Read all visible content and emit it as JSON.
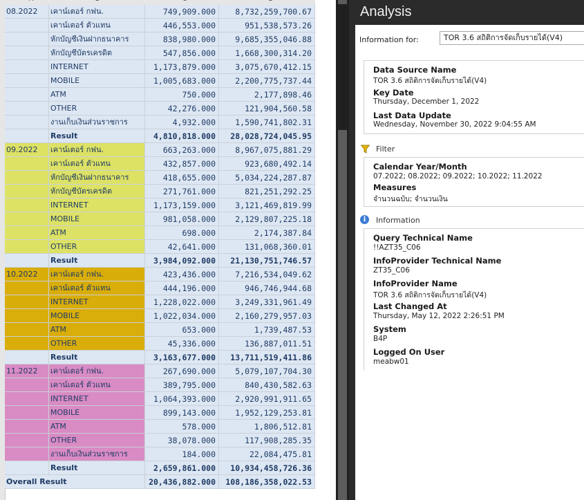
{
  "sheet": {
    "columns": [
      "A",
      "B",
      "C",
      "D"
    ],
    "rows": [
      {
        "period": "08.2022",
        "item": "เคาน์เตอร์ กฟน.",
        "qty": "749,909.000",
        "amount": "8,732,259,700.67",
        "style": "hb",
        "tri": true
      },
      {
        "period": "",
        "item": "เคาน์เตอร์ ตัวแทน",
        "qty": "446,553.000",
        "amount": "951,538,573.26",
        "style": "hb"
      },
      {
        "period": "",
        "item": "หักบัญชีเงินฝากธนาคาร",
        "qty": "838,980.000",
        "amount": "9,685,355,046.88",
        "style": "hb"
      },
      {
        "period": "",
        "item": "หักบัญชีบัตรเครดิต",
        "qty": "547,856.000",
        "amount": "1,668,300,314.20",
        "style": "hb"
      },
      {
        "period": "",
        "item": "INTERNET",
        "qty": "1,173,879.000",
        "amount": "3,075,670,412.15",
        "style": "hb"
      },
      {
        "period": "",
        "item": "MOBILE",
        "qty": "1,005,683.000",
        "amount": "2,200,775,737.44",
        "style": "hb"
      },
      {
        "period": "",
        "item": "ATM",
        "qty": "750.000",
        "amount": "2,177,898.46",
        "style": "hb"
      },
      {
        "period": "",
        "item": "OTHER",
        "qty": "42,276.000",
        "amount": "121,904,560.58",
        "style": "hb"
      },
      {
        "period": "",
        "item": "งานเก็บเงินส่วนราชการ",
        "qty": "4,932.000",
        "amount": "1,590,741,802.31",
        "style": "hb"
      },
      {
        "period": "",
        "item": "Result",
        "qty": "4,810,818.000",
        "amount": "28,028,724,045.95",
        "style": "hb",
        "result": true
      },
      {
        "period": "09.2022",
        "item": "เคาน์เตอร์ กฟน.",
        "qty": "663,263.000",
        "amount": "8,967,075,881.29",
        "style": "hy",
        "tri": true
      },
      {
        "period": "",
        "item": "เคาน์เตอร์ ตัวแทน",
        "qty": "432,857.000",
        "amount": "923,680,492.14",
        "style": "hy"
      },
      {
        "period": "",
        "item": "หักบัญชีเงินฝากธนาคาร",
        "qty": "418,655.000",
        "amount": "5,034,224,287.87",
        "style": "hy"
      },
      {
        "period": "",
        "item": "หักบัญชีบัตรเครดิต",
        "qty": "271,761.000",
        "amount": "821,251,292.25",
        "style": "hy"
      },
      {
        "period": "",
        "item": "INTERNET",
        "qty": "1,173,159.000",
        "amount": "3,121,469,819.99",
        "style": "hy"
      },
      {
        "period": "",
        "item": "MOBILE",
        "qty": "981,058.000",
        "amount": "2,129,807,225.18",
        "style": "hy"
      },
      {
        "period": "",
        "item": "ATM",
        "qty": "698.000",
        "amount": "2,174,387.84",
        "style": "hy"
      },
      {
        "period": "",
        "item": "OTHER",
        "qty": "42,641.000",
        "amount": "131,068,360.01",
        "style": "hy"
      },
      {
        "period": "",
        "item": "Result",
        "qty": "3,984,092.000",
        "amount": "21,130,751,746.57",
        "style": "hw",
        "result": true
      },
      {
        "period": "10.2022",
        "item": "เคาน์เตอร์ กฟน.",
        "qty": "423,436.000",
        "amount": "7,216,534,049.62",
        "style": "ho",
        "tri": true
      },
      {
        "period": "",
        "item": "เคาน์เตอร์ ตัวแทน",
        "qty": "444,196.000",
        "amount": "946,746,944.68",
        "style": "ho"
      },
      {
        "period": "",
        "item": "INTERNET",
        "qty": "1,228,022.000",
        "amount": "3,249,331,961.49",
        "style": "ho"
      },
      {
        "period": "",
        "item": "MOBILE",
        "qty": "1,022,034.000",
        "amount": "2,160,279,957.03",
        "style": "ho"
      },
      {
        "period": "",
        "item": "ATM",
        "qty": "653.000",
        "amount": "1,739,487.53",
        "style": "ho"
      },
      {
        "period": "",
        "item": "OTHER",
        "qty": "45,336.000",
        "amount": "136,887,011.51",
        "style": "ho"
      },
      {
        "period": "",
        "item": "Result",
        "qty": "3,163,677.000",
        "amount": "13,711,519,411.86",
        "style": "hw",
        "result": true
      },
      {
        "period": "11.2022",
        "item": "เคาน์เตอร์ กฟน.",
        "qty": "267,690.000",
        "amount": "5,079,107,704.30",
        "style": "hp",
        "tri": true
      },
      {
        "period": "",
        "item": "เคาน์เตอร์ ตัวแทน",
        "qty": "389,795.000",
        "amount": "840,430,582.63",
        "style": "hp"
      },
      {
        "period": "",
        "item": "INTERNET",
        "qty": "1,064,393.000",
        "amount": "2,920,991,911.65",
        "style": "hp"
      },
      {
        "period": "",
        "item": "MOBILE",
        "qty": "899,143.000",
        "amount": "1,952,129,253.81",
        "style": "hp"
      },
      {
        "period": "",
        "item": "ATM",
        "qty": "578.000",
        "amount": "1,806,512.81",
        "style": "hp"
      },
      {
        "period": "",
        "item": "OTHER",
        "qty": "38,078.000",
        "amount": "117,908,285.35",
        "style": "hp"
      },
      {
        "period": "",
        "item": "งานเก็บเงินส่วนราชการ",
        "qty": "184.000",
        "amount": "22,084,475.81",
        "style": "hp"
      },
      {
        "period": "",
        "item": "Result",
        "qty": "2,659,861.000",
        "amount": "10,934,458,726.36",
        "style": "hw",
        "result": true
      },
      {
        "period": "Overall Result",
        "item": "",
        "qty": "20,436,882.000",
        "amount": "108,186,358,022.53",
        "style": "hw",
        "overall": true
      }
    ]
  },
  "analysis": {
    "title": "Analysis",
    "info_for_label": "Information for:",
    "info_for_value": "TOR 3.6 สถิติการจัดเก็บรายได้(V4)",
    "data_source": {
      "l1": "Data Source Name",
      "v1": "TOR 3.6 สถิติการจัดเก็บรายได้(V4)",
      "l2": "Key Date",
      "v2": "Thursday, December 1, 2022",
      "l3": "Last Data Update",
      "v3": "Wednesday, November 30, 2022 9:04:55 AM"
    },
    "filter": {
      "section": "Filter",
      "l1": "Calendar Year/Month",
      "v1": "07.2022; 08.2022; 09.2022; 10.2022; 11.2022",
      "l2": "Measures",
      "v2": "จำนวนฉบับ; จำนวนเงิน"
    },
    "information": {
      "section": "Information",
      "l1": "Query Technical Name",
      "v1": "!!AZT35_C06",
      "l2": "InfoProvider Technical Name",
      "v2": "ZT35_C06",
      "l3": "InfoProvider Name",
      "v3": "TOR 3.6 สถิติการจัดเก็บรายได้(V4)",
      "l4": "Last Changed At",
      "v4": "Thursday, May 12, 2022 2:26:51 PM",
      "l5": "System",
      "v5": "B4P",
      "l6": "Logged On User",
      "v6": "meabw01"
    }
  }
}
